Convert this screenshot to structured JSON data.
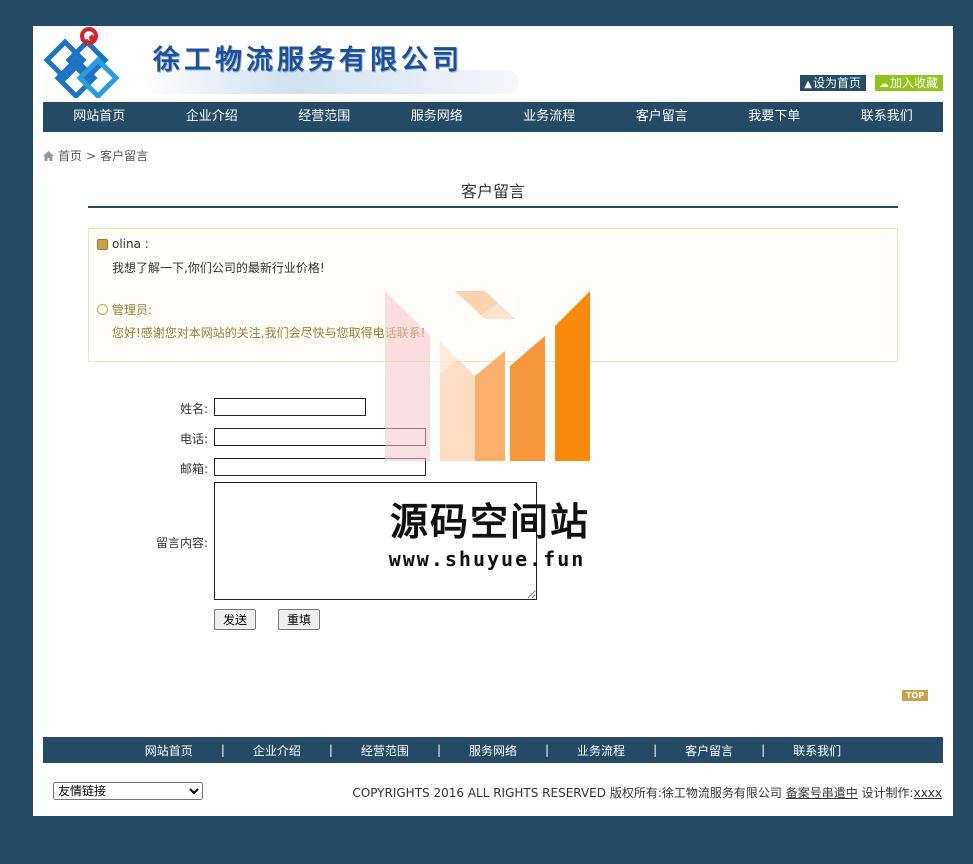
{
  "header": {
    "company_name": "徐工物流服务有限公司",
    "set_home": "设为首页",
    "add_favorite": "加入收藏"
  },
  "nav": {
    "items": [
      "网站首页",
      "企业介绍",
      "经营范围",
      "服务网络",
      "业务流程",
      "客户留言",
      "我要下单",
      "联系我们"
    ]
  },
  "breadcrumb": {
    "home": "首页",
    "separator": ">",
    "current": "客户留言"
  },
  "section": {
    "title": "客户留言"
  },
  "message": {
    "user_name": "olina :",
    "user_content": "我想了解一下,你们公司的最新行业价格!",
    "admin_name": "管理员:",
    "admin_reply": "您好!感谢您对本网站的关注,我们会尽快与您取得电话联系!"
  },
  "form": {
    "name_label": "姓名:",
    "phone_label": "电话:",
    "email_label": "邮箱:",
    "content_label": "留言内容:",
    "name_value": "",
    "phone_value": "",
    "email_value": "",
    "content_value": "",
    "submit_label": "发送",
    "reset_label": "重填"
  },
  "top_badge": "TOP",
  "footer": {
    "nav_items": [
      "网站首页",
      "企业介绍",
      "经营范围",
      "服务网络",
      "业务流程",
      "客户留言",
      "联系我们"
    ],
    "separator": "|",
    "friend_links_selected": "友情链接",
    "copyright": "COPYRIGHTS 2016  ALL RIGHTS RESERVED  版权所有:徐工物流服务有限公司",
    "icp_link": "备案号串遣中",
    "design_label": "设计制作:",
    "design_link": "xxxx"
  },
  "watermark": {
    "title": "源码空间站",
    "url": "www.shuyue.fun"
  },
  "colors": {
    "page_bg": "#244a66",
    "nav_bg": "#244a66",
    "favorite_bg": "#95c11f",
    "accent_gold": "#caa14e",
    "logo_blue": "#1d4f9a"
  }
}
